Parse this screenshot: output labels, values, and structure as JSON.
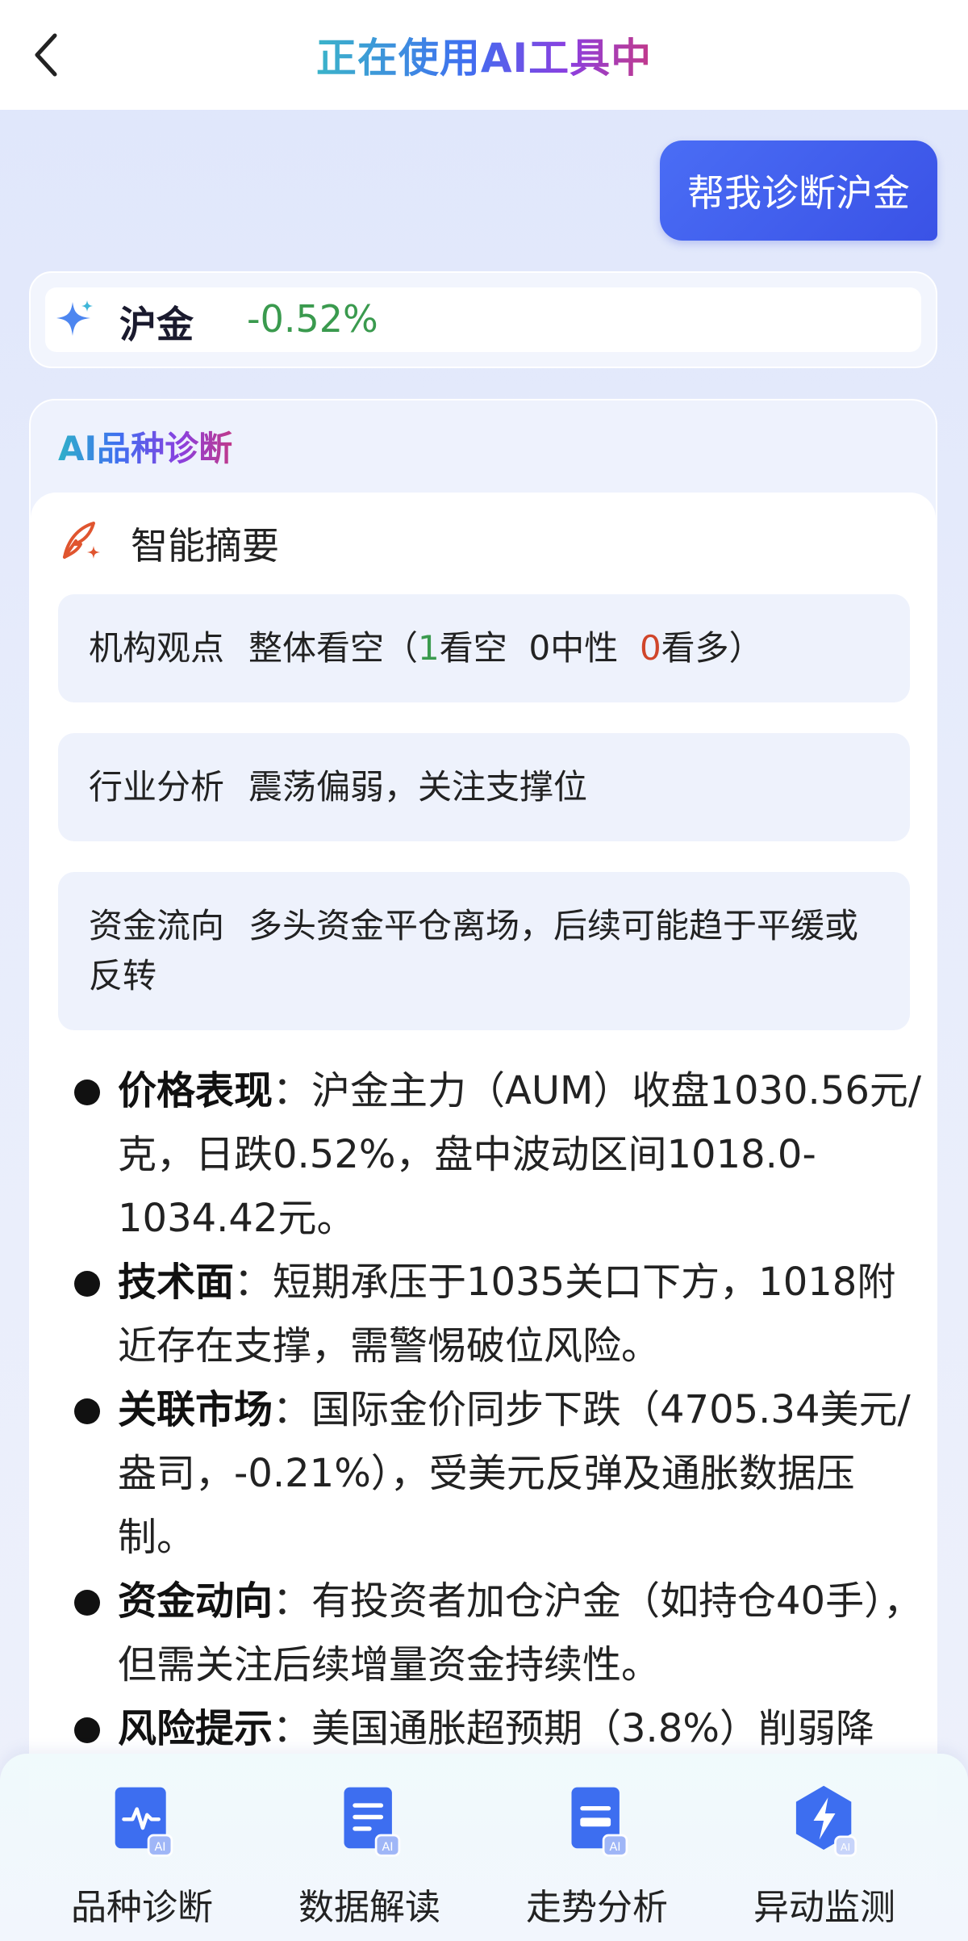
{
  "header": {
    "title": "正在使用AI工具中"
  },
  "user_message": "帮我诊断沪金",
  "quote": {
    "name": "沪金",
    "change": "-0.52%"
  },
  "card": {
    "title": "AI品种诊断",
    "summary_title": "智能摘要",
    "institution": {
      "label": "机构观点",
      "prefix": "整体看空（",
      "bear_count": "1",
      "bear_label": "看空",
      "neutral_count": "0",
      "neutral_label": "中性",
      "bull_count": "0",
      "bull_label": "看多）"
    },
    "industry": {
      "label": "行业分析",
      "text": "震荡偏弱，关注支撑位"
    },
    "fund_flow": {
      "label": "资金流向",
      "text": "多头资金平仓离场，后续可能趋于平缓或反转"
    },
    "bullets": [
      {
        "title": "价格表现",
        "text": "：沪金主力（AUM）收盘1030.56元/克，日跌0.52%，盘中波动区间1018.0-1034.42元。"
      },
      {
        "title": "技术面",
        "text": "：短期承压于1035关口下方，1018附近存在支撑，需警惕破位风险。"
      },
      {
        "title": "关联市场",
        "text": "：国际金价同步下跌（4705.34美元/盎司，-0.21%），受美元反弹及通胀数据压制。"
      },
      {
        "title": "资金动向",
        "text": "：有投资者加仓沪金（如持仓40手），但需关注后续增量资金持续性。"
      },
      {
        "title": "风险提示",
        "text": "：美国通胀超预期（3.8%）削弱降"
      }
    ]
  },
  "toolbar": {
    "items": [
      {
        "label": "品种诊断",
        "icon": "pulse-chart-ai-icon"
      },
      {
        "label": "数据解读",
        "icon": "document-ai-icon"
      },
      {
        "label": "走势分析",
        "icon": "card-ai-icon"
      },
      {
        "label": "异动监测",
        "icon": "lightning-hexagon-ai-icon"
      }
    ]
  },
  "colors": {
    "accent": "#3a52e6",
    "down_green": "#3a9a4e",
    "up_red": "#d0452a"
  }
}
